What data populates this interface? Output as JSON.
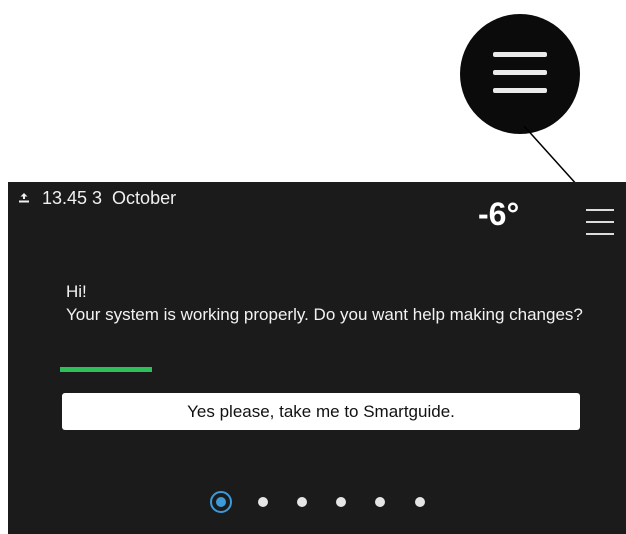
{
  "status": {
    "datetime": "13.45 3  October",
    "outdoor_temperature": "-6°",
    "icons": [
      "upload-icon",
      "menu-icon"
    ]
  },
  "message": {
    "greeting": "Hi!",
    "body": "Your system is working properly. Do you want help making changes?"
  },
  "actions": {
    "smartguide_label": "Yes please, take me to Smartguide."
  },
  "pager": {
    "count": 6,
    "active_index": 0
  },
  "colors": {
    "screen_bg": "#1b1b1b",
    "accent": "#2fbf5a",
    "active_dot": "#3c9ad9"
  }
}
